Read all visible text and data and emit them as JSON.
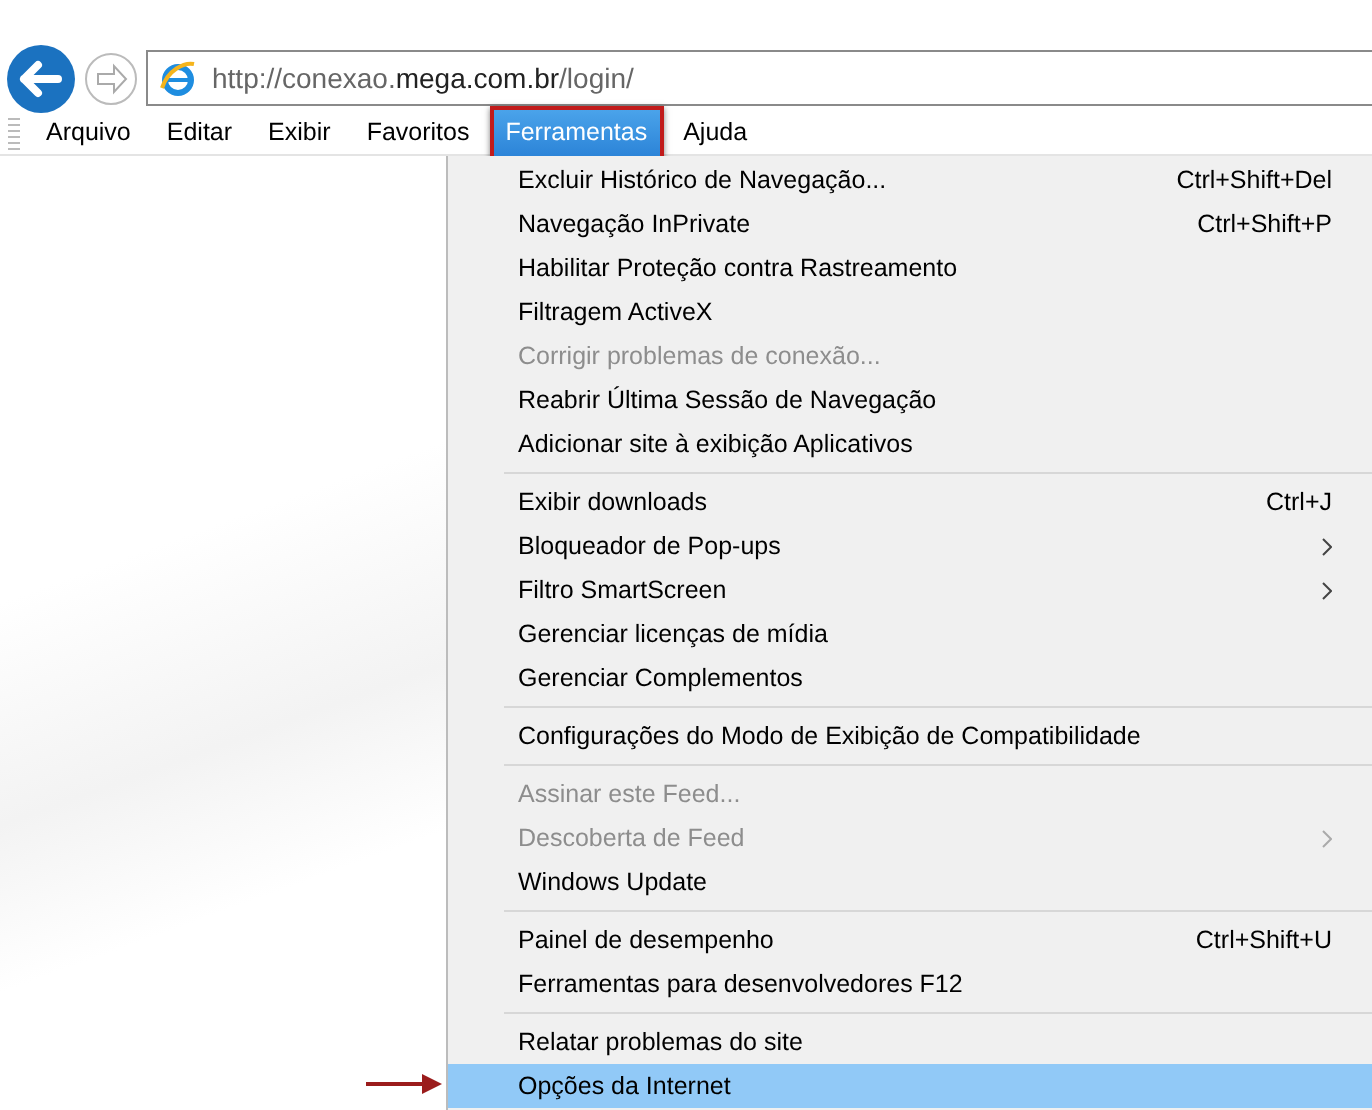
{
  "address_bar": {
    "url_before": "http://conexao.",
    "url_host": "mega.com.br",
    "url_after": "/login/"
  },
  "menu_bar": [
    {
      "label": "Arquivo",
      "selected": false
    },
    {
      "label": "Editar",
      "selected": false
    },
    {
      "label": "Exibir",
      "selected": false
    },
    {
      "label": "Favoritos",
      "selected": false
    },
    {
      "label": "Ferramentas",
      "selected": true
    },
    {
      "label": "Ajuda",
      "selected": false
    }
  ],
  "menu_groups": [
    [
      {
        "label": "Excluir Histórico de Navegação...",
        "shortcut": "Ctrl+Shift+Del",
        "disabled": false,
        "submenu": false,
        "selected": false
      },
      {
        "label": "Navegação InPrivate",
        "shortcut": "Ctrl+Shift+P",
        "disabled": false,
        "submenu": false,
        "selected": false
      },
      {
        "label": "Habilitar Proteção contra Rastreamento",
        "disabled": false,
        "submenu": false,
        "selected": false
      },
      {
        "label": "Filtragem ActiveX",
        "disabled": false,
        "submenu": false,
        "selected": false
      },
      {
        "label": "Corrigir problemas de conexão...",
        "disabled": true,
        "submenu": false,
        "selected": false
      },
      {
        "label": "Reabrir Última Sessão de Navegação",
        "disabled": false,
        "submenu": false,
        "selected": false
      },
      {
        "label": "Adicionar site à exibição Aplicativos",
        "disabled": false,
        "submenu": false,
        "selected": false
      }
    ],
    [
      {
        "label": "Exibir downloads",
        "shortcut": "Ctrl+J",
        "disabled": false,
        "submenu": false,
        "selected": false
      },
      {
        "label": "Bloqueador de Pop-ups",
        "disabled": false,
        "submenu": true,
        "selected": false
      },
      {
        "label": "Filtro SmartScreen",
        "disabled": false,
        "submenu": true,
        "selected": false
      },
      {
        "label": "Gerenciar licenças de mídia",
        "disabled": false,
        "submenu": false,
        "selected": false
      },
      {
        "label": "Gerenciar Complementos",
        "disabled": false,
        "submenu": false,
        "selected": false
      }
    ],
    [
      {
        "label": "Configurações do Modo de Exibição de Compatibilidade",
        "disabled": false,
        "submenu": false,
        "selected": false
      }
    ],
    [
      {
        "label": "Assinar este Feed...",
        "disabled": true,
        "submenu": false,
        "selected": false
      },
      {
        "label": "Descoberta de Feed",
        "disabled": true,
        "submenu": true,
        "selected": false
      },
      {
        "label": "Windows Update",
        "disabled": false,
        "submenu": false,
        "selected": false
      }
    ],
    [
      {
        "label": "Painel de desempenho",
        "shortcut": "Ctrl+Shift+U",
        "disabled": false,
        "submenu": false,
        "selected": false
      },
      {
        "label": "Ferramentas para desenvolvedores F12",
        "disabled": false,
        "submenu": false,
        "selected": false
      }
    ],
    [
      {
        "label": "Relatar problemas do site",
        "disabled": false,
        "submenu": false,
        "selected": false
      },
      {
        "label": "Opções da Internet",
        "disabled": false,
        "submenu": false,
        "selected": true
      }
    ]
  ]
}
